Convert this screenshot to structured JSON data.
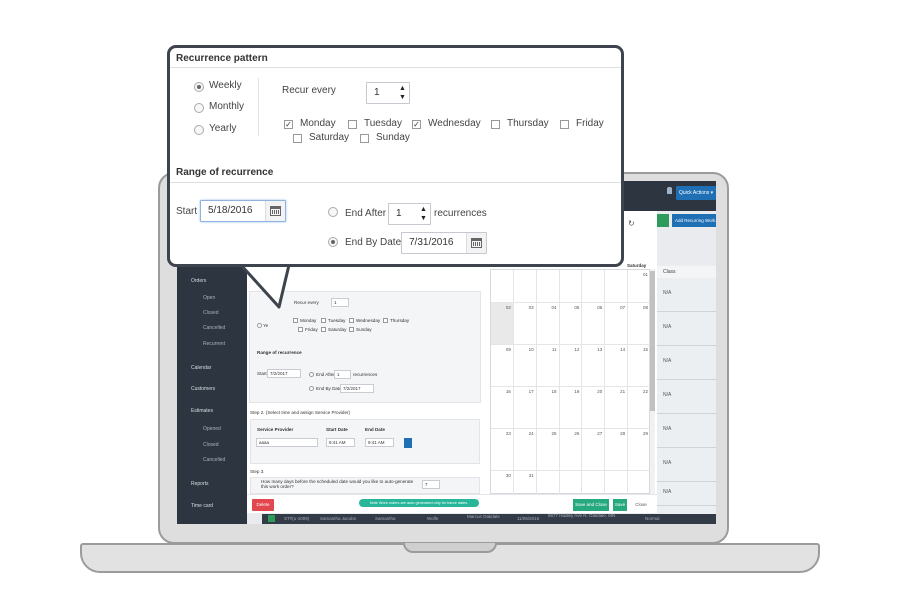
{
  "app": {
    "quick_actions": "Quick Actions ▾",
    "add_recurring": "Add Recurring Work",
    "sidebar": {
      "orders": "Orders",
      "open": "Open",
      "closed": "Closed",
      "cancelled": "Cancelled",
      "recurrent": "Recurrent",
      "calendar": "Calendar",
      "customers": "Customers",
      "estimates": "Estimates",
      "est_opened": "Opened",
      "est_closed": "Closed",
      "est_cancelled": "Cancelled",
      "reports": "Reports",
      "time_card": "Time card"
    },
    "table": {
      "class_header": "Class",
      "rows": [
        "N/A",
        "N/A",
        "N/A",
        "N/A",
        "N/A",
        "N/A",
        "N/A",
        "N/A"
      ]
    },
    "bottom_row": [
      "ST#(u-1009)",
      "Samantha Jacobs",
      "Samantha",
      "Wolfe",
      "Marcus Oakdale",
      "11/06/2016",
      "5677 Hadley Ave N. Oakdale, MN",
      "Normal"
    ]
  },
  "modal": {
    "recur_every_label": "Recur every",
    "recur_every_value": "1",
    "days": [
      "Monday",
      "Tuesday",
      "Wednesday",
      "Thursday",
      "Friday",
      "Saturday",
      "Sunday"
    ],
    "range_title": "Range of recurrence",
    "start_label": "Start",
    "start_value": "7/2/2017",
    "end_after_label": "End After",
    "end_after_value": "1",
    "recurrences_label": "recurrences",
    "end_by_label": "End By Date",
    "end_by_value": "7/2/2017",
    "step2": "Step 2. (Select time and assign Service Provider)",
    "service_provider_label": "Service Provider",
    "service_provider_value": "aaaa",
    "start_date_label": "Start Date",
    "start_date_value": "9:41 AM",
    "end_date_label": "End Date",
    "end_date_value": "9:41 AM",
    "step3": "Step 3.",
    "question": "How many days before the scheduled date would you like to auto-generate this work order?",
    "days_before_value": "7",
    "delete_label": "Delete",
    "note": "Note Work orders are auto generated only for future dates.",
    "save_close": "Save and Close",
    "save": "Save",
    "close": "Close",
    "calendar": {
      "saturday_label": "Saturday",
      "rows": [
        [
          "",
          "",
          "",
          "",
          "",
          "",
          "01"
        ],
        [
          "02",
          "03",
          "04",
          "05",
          "06",
          "07",
          "08"
        ],
        [
          "09",
          "10",
          "11",
          "12",
          "13",
          "14",
          "15"
        ],
        [
          "16",
          "17",
          "18",
          "19",
          "20",
          "21",
          "22"
        ],
        [
          "23",
          "24",
          "25",
          "26",
          "27",
          "28",
          "29"
        ],
        [
          "30",
          "31",
          "",
          "",
          "",
          "",
          ""
        ]
      ]
    }
  },
  "callout": {
    "pattern_title": "Recurrence pattern",
    "weekly": "Weekly",
    "monthly": "Monthly",
    "yearly": "Yearly",
    "recur_every_label": "Recur every",
    "recur_every_value": "1",
    "monday": "Monday",
    "tuesday": "Tuesday",
    "wednesday": "Wednesday",
    "thursday": "Thursday",
    "friday": "Friday",
    "saturday": "Saturday",
    "sunday": "Sunday",
    "range_title": "Range of recurrence",
    "start_label": "Start",
    "start_value": "5/18/2016",
    "end_after_label": "End After",
    "end_after_value": "1",
    "recurrences_label": "recurrences",
    "end_by_label": "End By Date",
    "end_by_value": "7/31/2016"
  }
}
